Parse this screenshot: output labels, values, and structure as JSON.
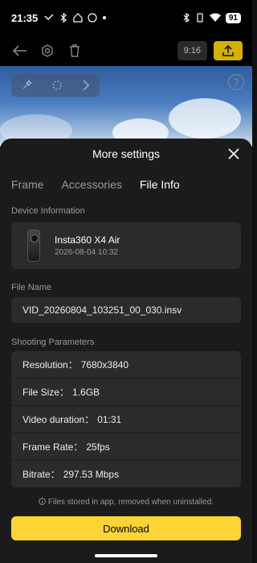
{
  "status": {
    "time": "21:35",
    "battery": "91"
  },
  "toolbar": {
    "ratio": "9:16"
  },
  "sheet": {
    "title": "More settings",
    "tabs": [
      "Frame",
      "Accessories",
      "File Info"
    ],
    "active_tab": "File Info"
  },
  "device": {
    "section": "Device Information",
    "name": "Insta360 X4 Air",
    "date": "2026-08-04 10:32"
  },
  "file": {
    "section": "File Name",
    "name": "VID_20260804_103251_00_030.insv"
  },
  "shooting": {
    "section": "Shooting Parameters",
    "params": [
      {
        "label": "Resolution：",
        "value": "7680x3840"
      },
      {
        "label": "File Size：",
        "value": "1.6GB"
      },
      {
        "label": "Video duration：",
        "value": "01:31"
      },
      {
        "label": "Frame Rate：",
        "value": "25fps"
      },
      {
        "label": "Bitrate：",
        "value": "297.53 Mbps"
      }
    ]
  },
  "footer": {
    "note_icon": "info-icon",
    "note": "Files stored in app, removed when uninstalled.",
    "download": "Download"
  },
  "colors": {
    "accent": "#fcd535",
    "sheet": "#1b1b1b",
    "card": "#2b2b2b"
  }
}
